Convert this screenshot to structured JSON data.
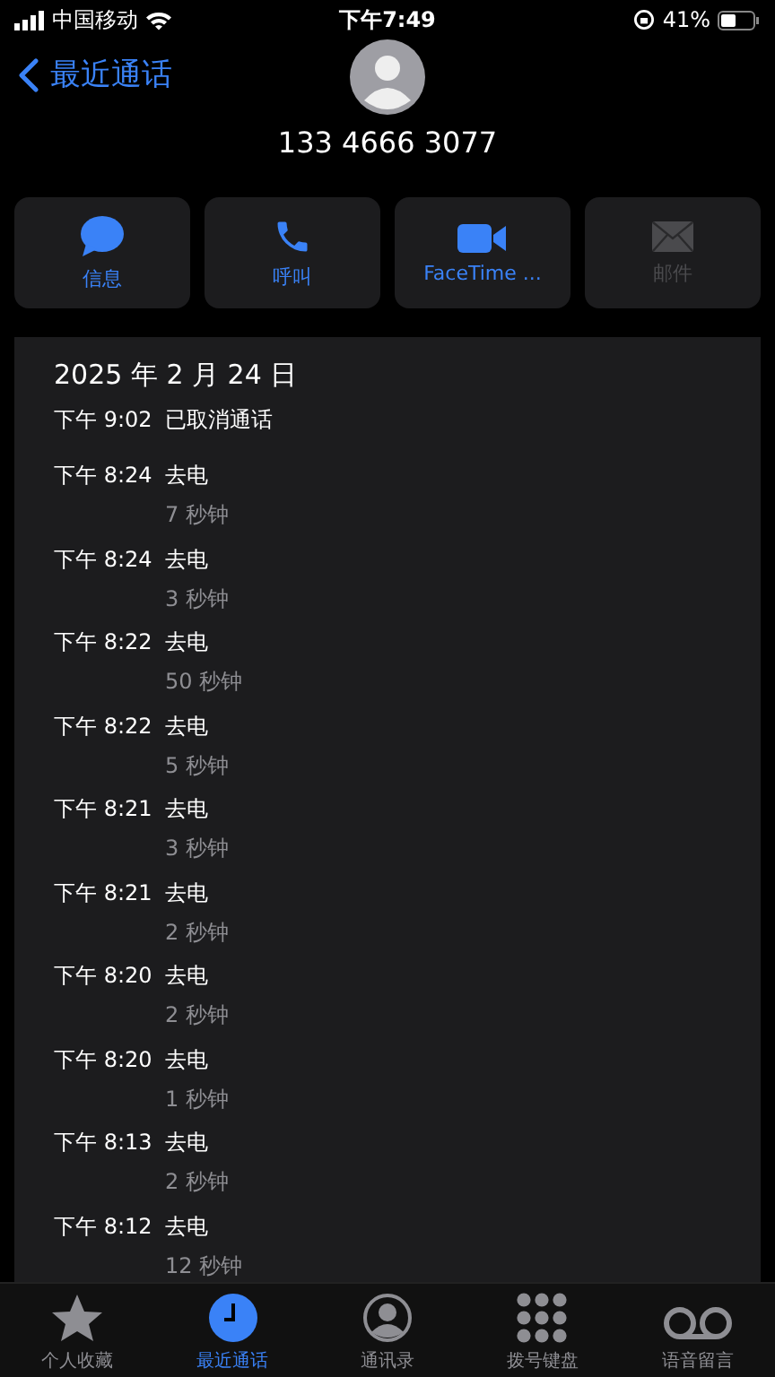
{
  "status_bar": {
    "carrier": "中国移动",
    "time": "下午7:49",
    "battery": "41%"
  },
  "nav": {
    "back": "最近通话"
  },
  "contact": {
    "number": "133 4666 3077"
  },
  "actions": [
    {
      "kind": "message",
      "label": "信息",
      "disabled": false
    },
    {
      "kind": "call",
      "label": "呼叫",
      "disabled": false
    },
    {
      "kind": "video",
      "label": "FaceTime ...",
      "disabled": false
    },
    {
      "kind": "mail",
      "label": "邮件",
      "disabled": true
    }
  ],
  "call_log": {
    "date": "2025 年 2 月 24 日",
    "entries": [
      {
        "time": "下午 9:02",
        "type": "已取消通话"
      },
      {
        "time": "下午 8:24",
        "type": "去电",
        "duration": "7 秒钟"
      },
      {
        "time": "下午 8:24",
        "type": "去电",
        "duration": "3 秒钟"
      },
      {
        "time": "下午 8:22",
        "type": "去电",
        "duration": "50 秒钟"
      },
      {
        "time": "下午 8:22",
        "type": "去电",
        "duration": "5 秒钟"
      },
      {
        "time": "下午 8:21",
        "type": "去电",
        "duration": "3 秒钟"
      },
      {
        "time": "下午 8:21",
        "type": "去电",
        "duration": "2 秒钟"
      },
      {
        "time": "下午 8:20",
        "type": "去电",
        "duration": "2 秒钟"
      },
      {
        "time": "下午 8:20",
        "type": "去电",
        "duration": "1 秒钟"
      },
      {
        "time": "下午 8:13",
        "type": "去电",
        "duration": "2 秒钟"
      },
      {
        "time": "下午 8:12",
        "type": "去电",
        "duration": "12 秒钟"
      }
    ]
  },
  "tab_bar": [
    {
      "kind": "star",
      "label": "个人收藏",
      "selected": false
    },
    {
      "kind": "clock",
      "label": "最近通话",
      "selected": true
    },
    {
      "kind": "person",
      "label": "通讯录",
      "selected": false
    },
    {
      "kind": "keypad",
      "label": "拨号键盘",
      "selected": false
    },
    {
      "kind": "voicemail",
      "label": "语音留言",
      "selected": false
    }
  ]
}
